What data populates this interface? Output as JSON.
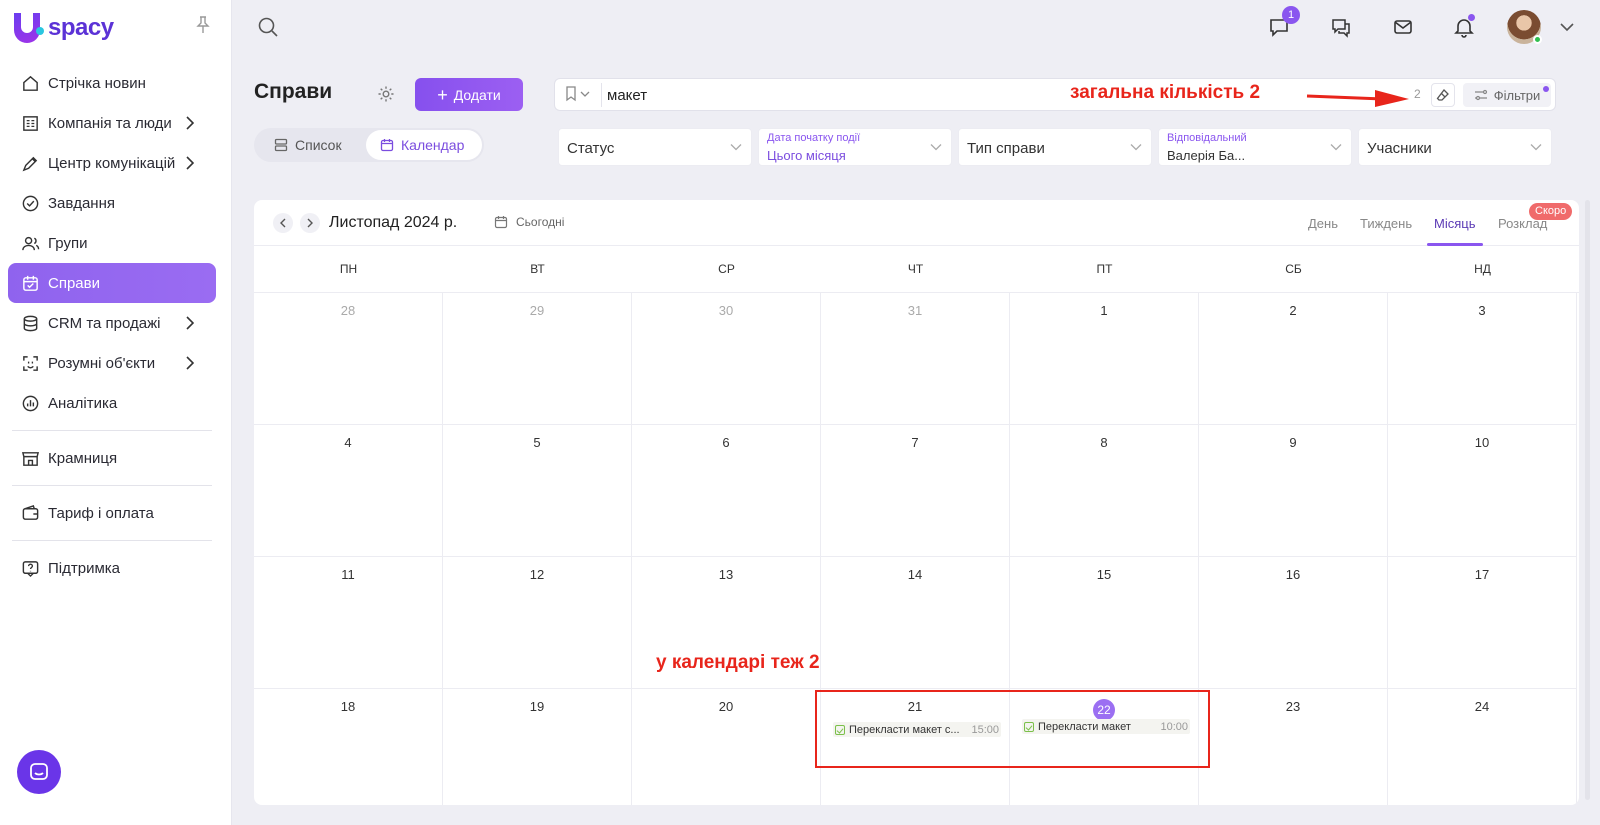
{
  "brand": {
    "name": "spacy"
  },
  "sidebar": {
    "items": [
      {
        "label": "Стрічка новин",
        "icon": "home-icon",
        "chevron": false,
        "active": false
      },
      {
        "label": "Компанія та люди",
        "icon": "company-icon",
        "chevron": true,
        "active": false
      },
      {
        "label": "Центр комунікацій",
        "icon": "communication-icon",
        "chevron": true,
        "active": false
      },
      {
        "label": "Завдання",
        "icon": "tasks-icon",
        "chevron": false,
        "active": false
      },
      {
        "label": "Групи",
        "icon": "groups-icon",
        "chevron": false,
        "active": false
      },
      {
        "label": "Справи",
        "icon": "calendar-check-icon",
        "chevron": false,
        "active": true
      },
      {
        "label": "CRM та продажі",
        "icon": "crm-icon",
        "chevron": true,
        "active": false
      },
      {
        "label": "Розумні об'єкти",
        "icon": "smart-objects-icon",
        "chevron": true,
        "active": false
      },
      {
        "label": "Аналітика",
        "icon": "analytics-icon",
        "chevron": false,
        "active": false
      }
    ],
    "store": "Крамниця",
    "tariff": "Тариф і оплата",
    "support": "Підтримка"
  },
  "topbar": {
    "chat_badge": "1"
  },
  "header": {
    "title": "Справи",
    "add_button": "Додати",
    "view_list": "Список",
    "view_calendar": "Календар"
  },
  "search": {
    "value": "макет",
    "count": "2",
    "filters_label": "Фільтри"
  },
  "filters": {
    "status": "Статус",
    "start_date_label": "Дата початку події",
    "start_date_value": "Цього місяця",
    "type": "Тип справи",
    "responsible_label": "Відповідальний",
    "responsible_value": "Валерія Ба...",
    "participants": "Учасники"
  },
  "calendar": {
    "month_title": "Листопад 2024 р.",
    "today_label": "Сьогодні",
    "views": {
      "day": "День",
      "week": "Тиждень",
      "month": "Місяць",
      "schedule": "Розклад"
    },
    "soon_badge": "Скоро",
    "weekdays": [
      "ПН",
      "ВТ",
      "СР",
      "ЧТ",
      "ПТ",
      "СБ",
      "НД"
    ],
    "weeks": [
      [
        "28",
        "29",
        "30",
        "31",
        "1",
        "2",
        "3"
      ],
      [
        "4",
        "5",
        "6",
        "7",
        "8",
        "9",
        "10"
      ],
      [
        "11",
        "12",
        "13",
        "14",
        "15",
        "16",
        "17"
      ],
      [
        "18",
        "19",
        "20",
        "21",
        "22",
        "23",
        "24"
      ]
    ],
    "today": "22",
    "events": [
      {
        "title": "Перекласти макет с...",
        "time": "15:00",
        "day": "21"
      },
      {
        "title": "Перекласти макет",
        "time": "10:00",
        "day": "22"
      }
    ]
  },
  "annotations": {
    "top": "загальна кількість 2",
    "calendar": "у календарі теж 2"
  },
  "colors": {
    "accent": "#8a56ef",
    "annotation": "#e8251b"
  }
}
